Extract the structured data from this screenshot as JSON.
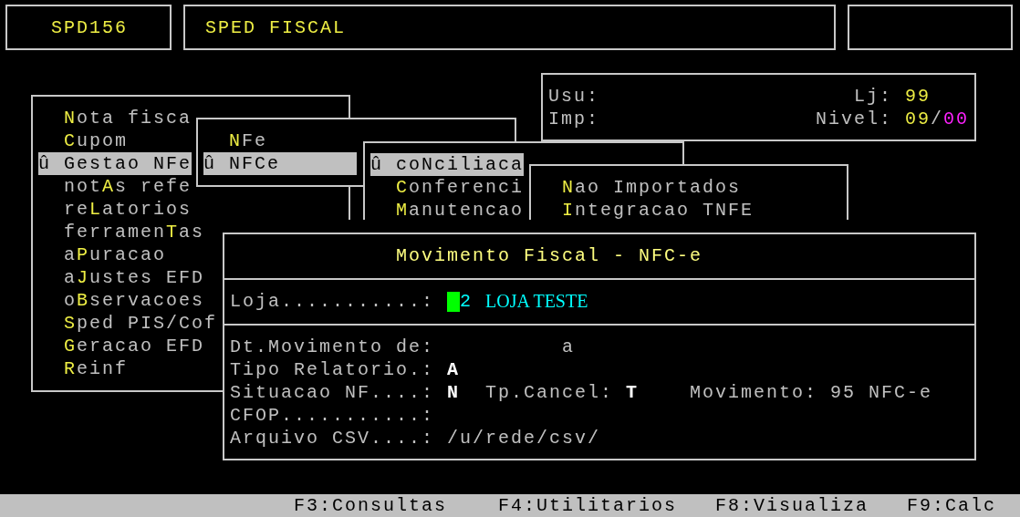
{
  "header": {
    "program_code": "SPD156",
    "title": "SPED FISCAL"
  },
  "user_info": {
    "user_label": "Usu:",
    "store_label": "Lj:",
    "store": "99",
    "printer_label": "Imp:",
    "nivel_label": "Nivel:",
    "nivel": "09",
    "nivel_separator": "/",
    "nivel_max": "00"
  },
  "menus": [
    {
      "items": [
        {
          "hotkey": "N",
          "label_end": "ota fisca",
          "selected": false
        },
        {
          "hotkey": "C",
          "label_end": "upom",
          "selected": false
        },
        {
          "marker": "û",
          "label_start": "Gestao NFe",
          "selected": true
        },
        {
          "label_start": "not",
          "hotkey": "A",
          "label_end": "s refe",
          "selected": false
        },
        {
          "label_start": "re",
          "hotkey": "L",
          "label_end": "atorios",
          "selected": false
        },
        {
          "label_start": "ferramen",
          "hotkey": "T",
          "label_end": "as",
          "selected": false
        },
        {
          "label_start": "a",
          "hotkey": "P",
          "label_end": "uracao",
          "selected": false
        },
        {
          "label_start": "a",
          "hotkey": "J",
          "label_end": "ustes EFD",
          "selected": false
        },
        {
          "label_start": "o",
          "hotkey": "B",
          "label_end": "servacoes",
          "selected": false
        },
        {
          "hotkey": "S",
          "label_end": "ped PIS/Cof",
          "selected": false
        },
        {
          "hotkey": "G",
          "label_end": "eracao EFD",
          "selected": false
        },
        {
          "hotkey": "R",
          "label_end": "einf",
          "selected": false
        }
      ]
    },
    {
      "items": [
        {
          "hotkey": "N",
          "label_end": "Fe",
          "selected": false
        },
        {
          "marker": "û",
          "label_start": "NFCe",
          "selected": true
        }
      ]
    },
    {
      "items": [
        {
          "marker": "û",
          "label_start": "coNciliaca",
          "selected": true
        },
        {
          "hotkey": "C",
          "label_end": "onferenci",
          "selected": false
        },
        {
          "hotkey": "M",
          "label_end": "anutencao",
          "selected": false
        }
      ]
    },
    {
      "items": [
        {
          "hotkey": "N",
          "label_end": "ao Importados",
          "selected": false
        },
        {
          "hotkey": "I",
          "label_end": "ntegracao TNFE",
          "selected": false
        }
      ]
    }
  ],
  "dialog": {
    "title": "Movimento Fiscal - NFC-e",
    "store": {
      "label": "Loja...........:",
      "code": "2",
      "name": "LOJA TESTE"
    },
    "fields": [
      {
        "kind": "range",
        "label": "Dt.Movimento de:",
        "separator": "a"
      },
      {
        "kind": "value",
        "label": "Tipo Relatorio.:",
        "value": "A"
      },
      {
        "kind": "situation",
        "label": "Situacao NF....:",
        "value": "N",
        "cancel_label": "Tp.Cancel:",
        "cancel_value": "T",
        "movement_label": "Movimento:",
        "movement_value": "95 NFC-e"
      },
      {
        "kind": "value",
        "label": "CFOP...........:"
      },
      {
        "kind": "path",
        "label": "Arquivo CSV....:",
        "value": "/u/rede/csv/"
      }
    ]
  },
  "status_bar": [
    "F3:Consultas",
    "F4:Utilitarios",
    "F8:Visualiza",
    "F9:Calc"
  ]
}
